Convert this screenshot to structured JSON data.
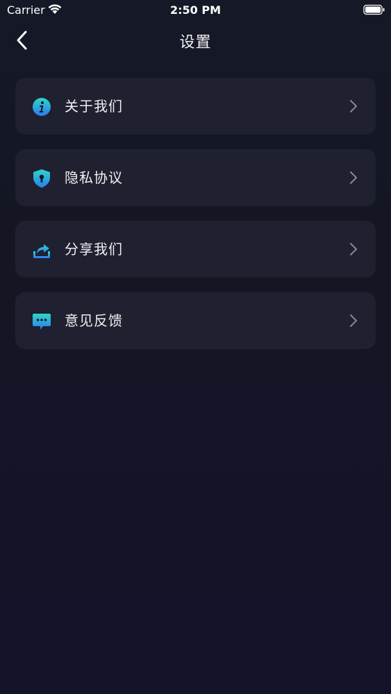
{
  "status_bar": {
    "carrier": "Carrier",
    "time": "2:50 PM"
  },
  "nav": {
    "title": "设置",
    "back_icon": "chevron-left-icon"
  },
  "menu": {
    "items": [
      {
        "label": "关于我们",
        "icon": "info-icon"
      },
      {
        "label": "隐私协议",
        "icon": "shield-lock-icon"
      },
      {
        "label": "分享我们",
        "icon": "share-icon"
      },
      {
        "label": "意见反馈",
        "icon": "feedback-chat-icon"
      }
    ]
  },
  "colors": {
    "background": "#141624",
    "card": "#1f2030",
    "icon_gradient_start": "#2fd6c8",
    "icon_gradient_end": "#2a7cf0",
    "chevron": "#8a8b94"
  }
}
